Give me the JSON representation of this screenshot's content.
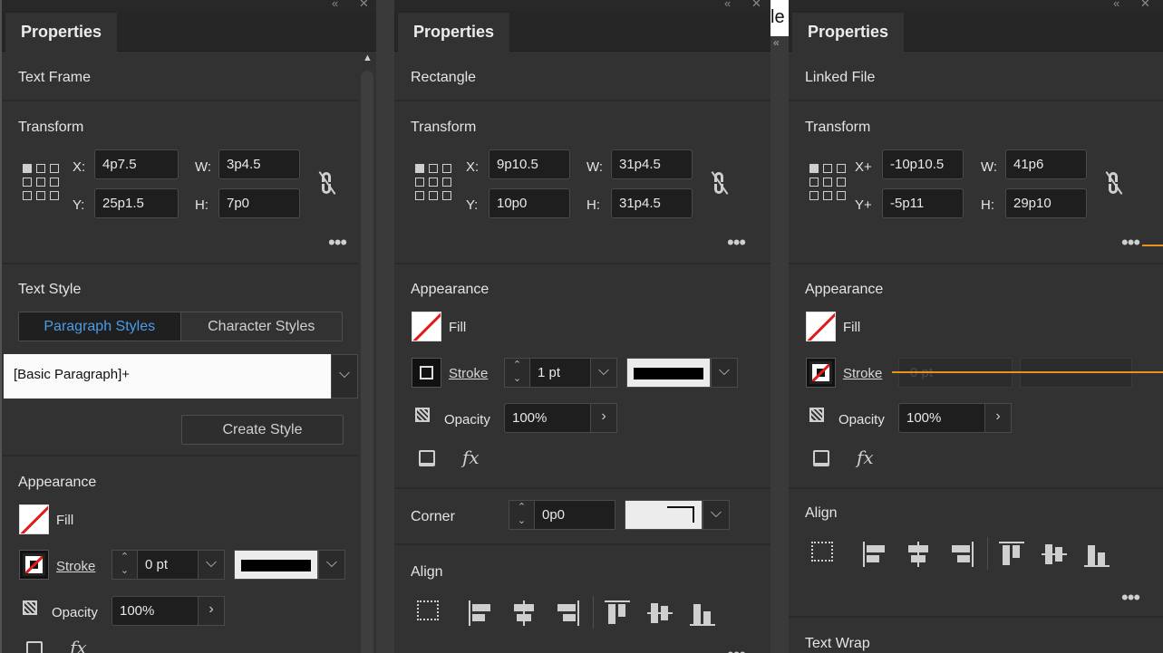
{
  "panels": [
    {
      "tab": "Properties",
      "object_type": "Text Frame",
      "transform": {
        "heading": "Transform",
        "x_label": "X:",
        "x": "4p7.5",
        "y_label": "Y:",
        "y": "25p1.5",
        "w_label": "W:",
        "w": "3p4.5",
        "h_label": "H:",
        "h": "7p0"
      },
      "more": "•••",
      "text_style": {
        "heading": "Text Style",
        "tab_paragraph": "Paragraph Styles",
        "tab_character": "Character Styles",
        "selected_style": "[Basic Paragraph]+",
        "create_style": "Create Style"
      },
      "appearance": {
        "heading": "Appearance",
        "fill": "Fill",
        "stroke": "Stroke",
        "stroke_weight": "0 pt",
        "opacity_label": "Opacity",
        "opacity": "100%"
      }
    },
    {
      "tab": "Properties",
      "object_type": "Rectangle",
      "transform": {
        "heading": "Transform",
        "x_label": "X:",
        "x": "9p10.5",
        "y_label": "Y:",
        "y": "10p0",
        "w_label": "W:",
        "w": "31p4.5",
        "h_label": "H:",
        "h": "31p4.5"
      },
      "more": "•••",
      "appearance": {
        "heading": "Appearance",
        "fill": "Fill",
        "stroke": "Stroke",
        "stroke_weight": "1 pt",
        "opacity_label": "Opacity",
        "opacity": "100%"
      },
      "corner": {
        "label": "Corner",
        "value": "0p0"
      },
      "align": {
        "heading": "Align"
      }
    },
    {
      "tab": "Properties",
      "object_type": "Linked File",
      "transform": {
        "heading": "Transform",
        "x_label": "X+",
        "x": "-10p10.5",
        "y_label": "Y+",
        "y": "-5p11",
        "w_label": "W:",
        "w": "41p6",
        "h_label": "H:",
        "h": "29p10"
      },
      "more": "•••",
      "appearance": {
        "heading": "Appearance",
        "fill": "Fill",
        "stroke": "Stroke",
        "stroke_weight_ghost": "0 pt",
        "opacity_label": "Opacity",
        "opacity": "100%"
      },
      "align": {
        "heading": "Align"
      },
      "text_wrap": {
        "heading": "Text Wrap"
      }
    }
  ],
  "between_text": "le",
  "colors": {
    "panel_bg": "#323232",
    "accent_blue": "#4a9ce8",
    "highlight_orange": "#e8931f",
    "none_red": "#e21a1a"
  }
}
